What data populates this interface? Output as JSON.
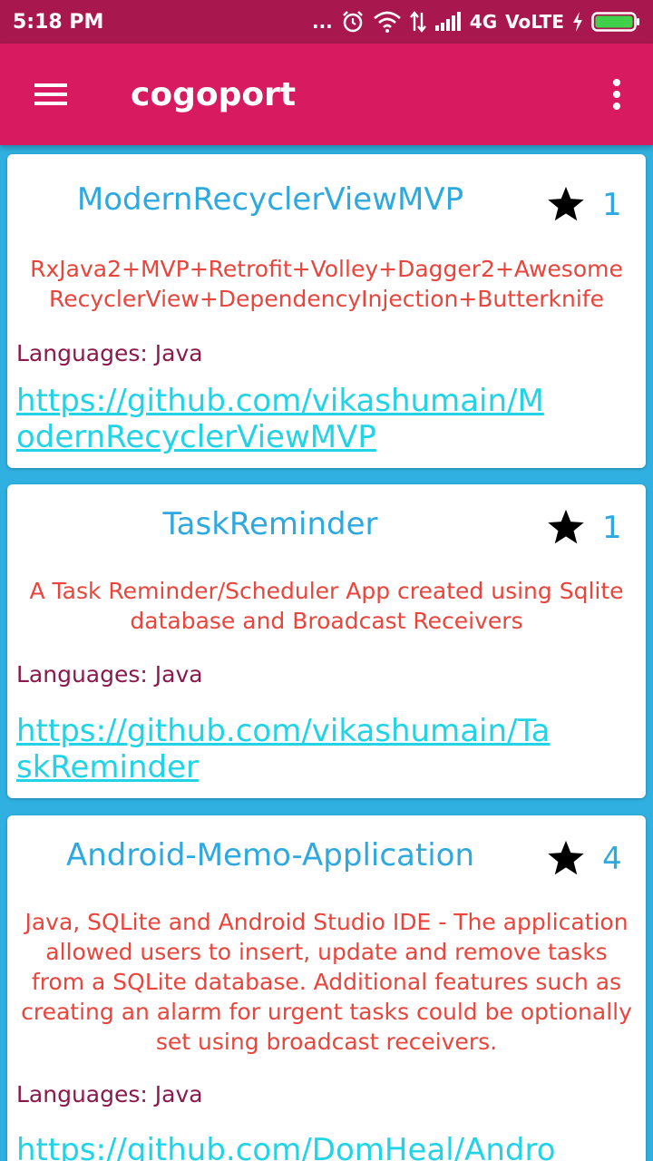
{
  "status_bar": {
    "time": "5:18 PM",
    "dots": "...",
    "network": "4G",
    "volte": "VoLTE"
  },
  "app_bar": {
    "title": "cogoport",
    "menu_icon": "hamburger-menu-icon",
    "more_icon": "more-vert-icon"
  },
  "repos": [
    {
      "name": "ModernRecyclerViewMVP",
      "stars": "1",
      "description": "RxJava2+MVP+Retrofit+Volley+Dagger2+Awesome RecyclerView+DependencyInjection+Butterknife",
      "languages": "Languages: Java",
      "url": "https://github.com/vikashumain/ModernRecyclerViewMVP"
    },
    {
      "name": "TaskReminder",
      "stars": "1",
      "description": "A Task Reminder/Scheduler App created using Sqlite database and Broadcast Receivers",
      "languages": "Languages: Java",
      "url": "https://github.com/vikashumain/TaskReminder"
    },
    {
      "name": "Android-Memo-Application",
      "stars": "4",
      "description": "Java, SQLite and Android Studio IDE - The application allowed users to insert, update and remove tasks from a SQLite database. Additional features such as creating an alarm for urgent tasks could be optionally set using broadcast receivers.",
      "languages": "Languages: Java",
      "url": "https://github.com/DomHeal/Android-"
    }
  ],
  "colors": {
    "status_bar": "#a8184f",
    "app_bar": "#d81b60",
    "background": "#2fb0e0",
    "repo_name": "#2ea9e0",
    "description": "#e8453c",
    "languages": "#8a1a4b",
    "link": "#22d3e6"
  }
}
